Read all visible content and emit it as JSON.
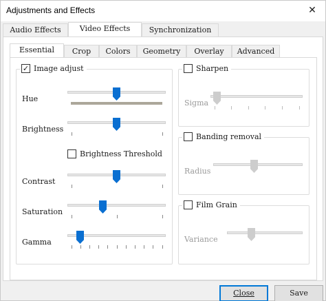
{
  "window": {
    "title": "Adjustments and Effects",
    "close_glyph": "✕"
  },
  "top_tabs": [
    "Audio Effects",
    "Video Effects",
    "Synchronization"
  ],
  "sub_tabs": [
    "Essential",
    "Crop",
    "Colors",
    "Geometry",
    "Overlay",
    "Advanced"
  ],
  "image_adjust": {
    "label": "Image adjust",
    "checked": true,
    "check_glyph": "✓",
    "hue_label": "Hue",
    "brightness_label": "Brightness",
    "brightness_threshold_label": "Brightness Threshold",
    "contrast_label": "Contrast",
    "saturation_label": "Saturation",
    "gamma_label": "Gamma"
  },
  "sliders": {
    "hue": 0.5,
    "brightness": 0.5,
    "contrast": 0.5,
    "saturation": 0.35,
    "gamma": 0.1,
    "sigma": 0.03,
    "radius": 0.45,
    "variance": 0.3
  },
  "sharpen": {
    "label": "Sharpen",
    "checked": false,
    "param_label": "Sigma"
  },
  "banding": {
    "label": "Banding removal",
    "checked": false,
    "param_label": "Radius"
  },
  "film_grain": {
    "label": "Film Grain",
    "checked": false,
    "param_label": "Variance"
  },
  "buttons": {
    "close": "Close",
    "save": "Save"
  },
  "colors": {
    "accent": "#0a6fd1",
    "focus_border": "#0078d7"
  }
}
